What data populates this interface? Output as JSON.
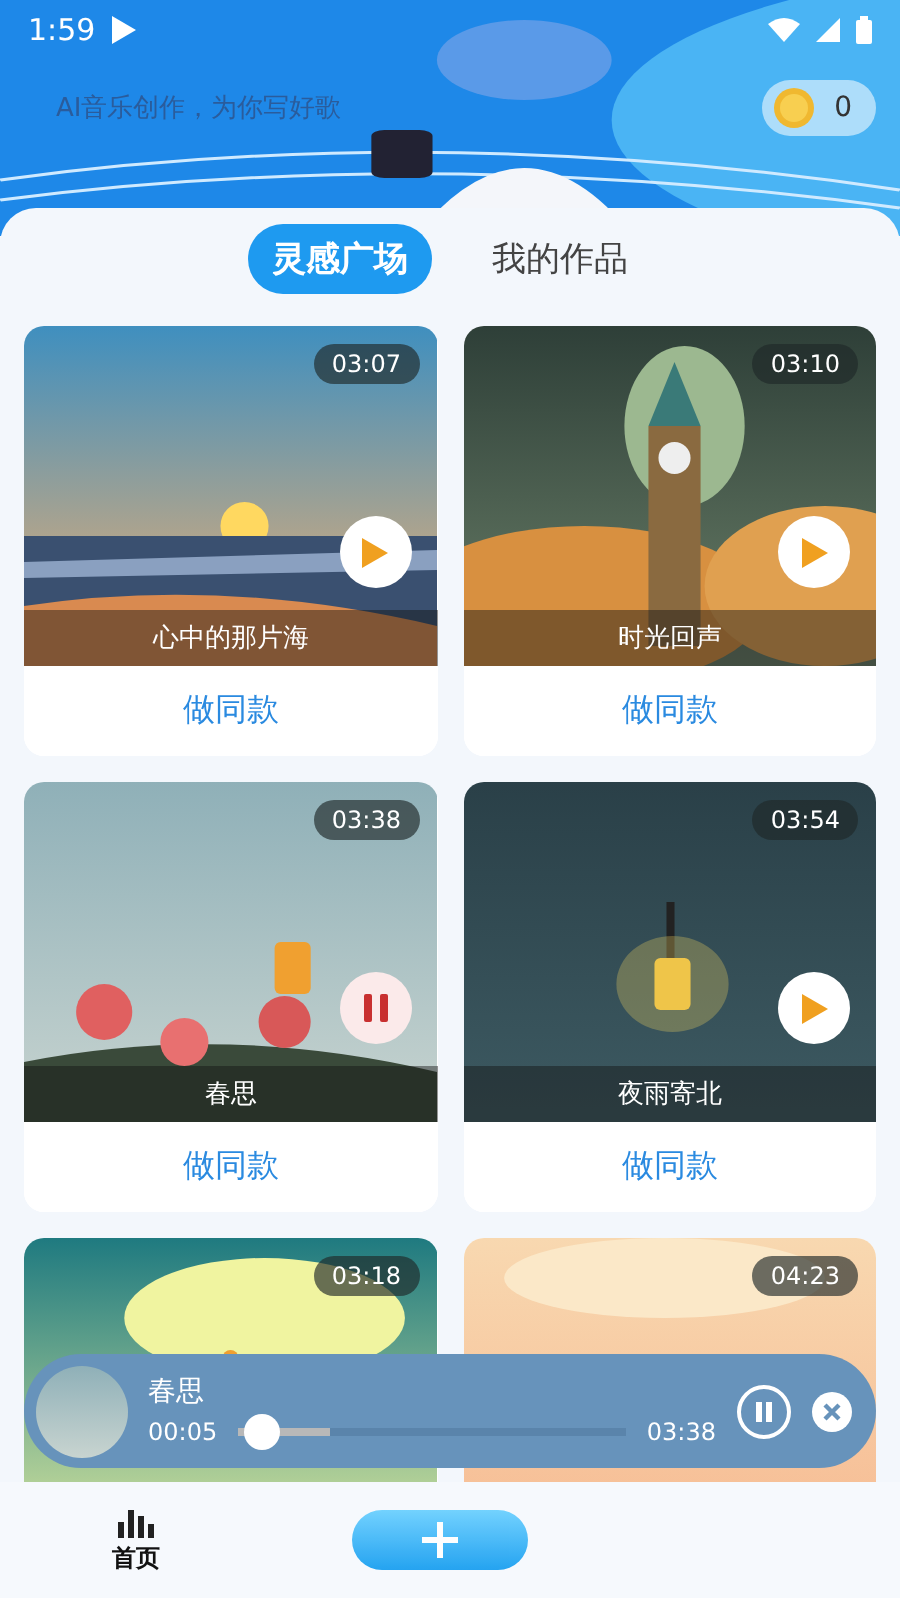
{
  "status_bar": {
    "time": "1:59"
  },
  "header": {
    "slogan": "AI音乐创作，为你写好歌",
    "coins": "0"
  },
  "tabs": [
    {
      "label": "灵感广场",
      "selected": true
    },
    {
      "label": "我的作品",
      "selected": false
    }
  ],
  "songs": [
    {
      "title": "心中的那片海",
      "duration": "03:07",
      "playing": false,
      "action": "做同款"
    },
    {
      "title": "时光回声",
      "duration": "03:10",
      "playing": false,
      "action": "做同款"
    },
    {
      "title": "春思",
      "duration": "03:38",
      "playing": true,
      "action": "做同款"
    },
    {
      "title": "夜雨寄北",
      "duration": "03:54",
      "playing": false,
      "action": "做同款"
    },
    {
      "duration": "03:18"
    },
    {
      "duration": "04:23"
    }
  ],
  "player": {
    "title": "春思",
    "elapsed": "00:05",
    "total": "03:38",
    "level": 0.02,
    "playing": true
  },
  "bottom_nav": [
    {
      "kind": "home",
      "label": "首页",
      "selected": true
    },
    {
      "kind": "create",
      "selected": false
    }
  ]
}
